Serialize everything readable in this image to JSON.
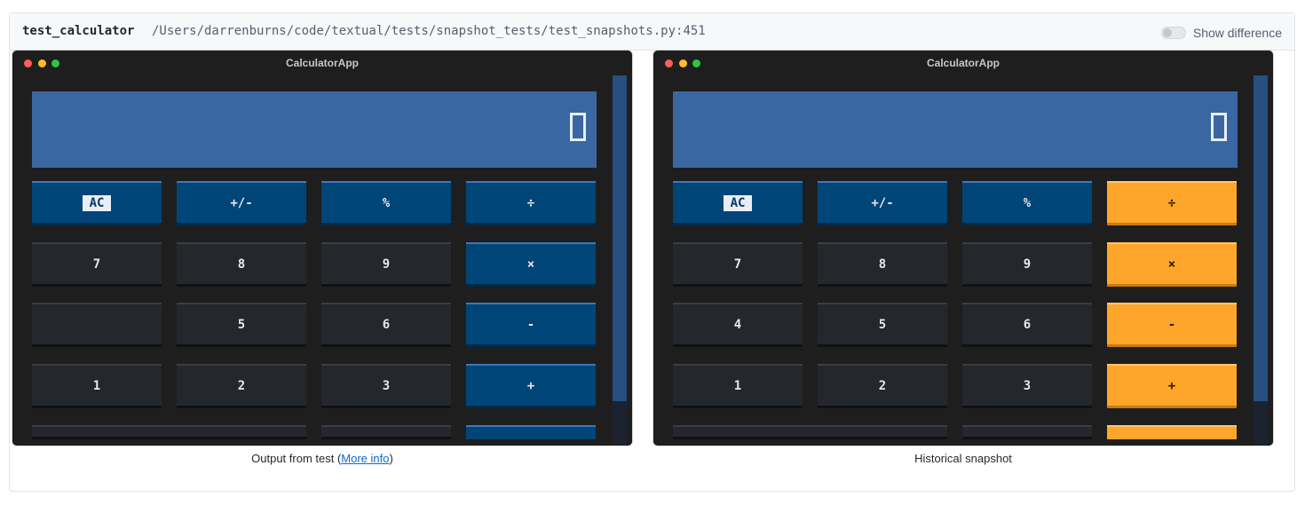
{
  "header": {
    "test_name": "test_calculator",
    "test_path": "/Users/darrenburns/code/textual/tests/snapshot_tests/test_snapshots.py:451",
    "toggle_label": "Show difference",
    "toggle_on": false
  },
  "left": {
    "window_title": "CalculatorApp",
    "caption_prefix": "Output from test (",
    "caption_link": "More info",
    "caption_suffix": ")",
    "rows": [
      [
        "AC",
        "+/-",
        "%",
        "÷"
      ],
      [
        "7",
        "8",
        "9",
        "×"
      ],
      [
        "",
        "5",
        "6",
        "-"
      ],
      [
        "1",
        "2",
        "3",
        "+"
      ]
    ]
  },
  "right": {
    "window_title": "CalculatorApp",
    "caption": "Historical snapshot",
    "rows": [
      [
        "AC",
        "+/-",
        "%",
        "÷"
      ],
      [
        "7",
        "8",
        "9",
        "×"
      ],
      [
        "4",
        "5",
        "6",
        "-"
      ],
      [
        "1",
        "2",
        "3",
        "+"
      ]
    ]
  },
  "colors": {
    "display": "#3a67a1",
    "operator_left": "#004578",
    "operator_right": "#fea62b",
    "number_button": "#24272b",
    "window_bg": "#1e1e1e"
  }
}
